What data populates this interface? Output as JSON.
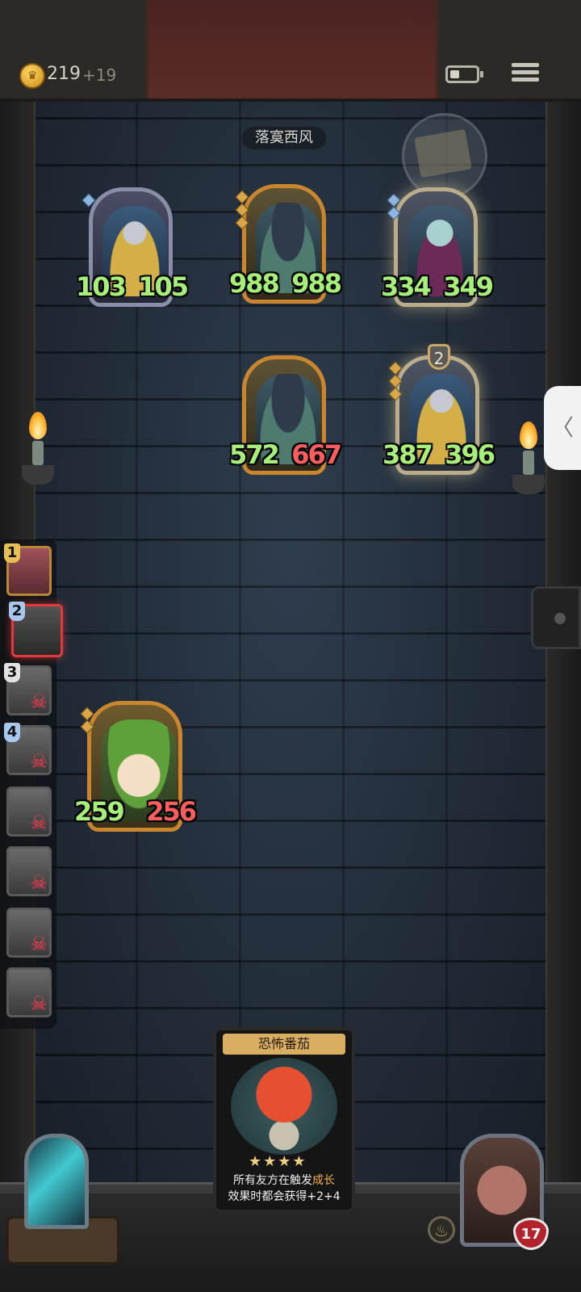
{
  "topbar": {
    "coin_icon": "crown-coin-icon",
    "gold": "219",
    "gold_bonus": "+19",
    "battery_level": 0.35,
    "menu_icon": "hamburger-menu-icon"
  },
  "area": {
    "title": "落寞西风"
  },
  "enemies": [
    {
      "atk": "103",
      "hp": "105",
      "portrait": "knight",
      "frame": "silver"
    },
    {
      "atk": "988",
      "hp": "988",
      "portrait": "robot",
      "frame": "gold"
    },
    {
      "atk": "334",
      "hp": "349",
      "portrait": "elf",
      "frame": "glow"
    },
    {
      "atk": "572",
      "hp": "667",
      "portrait": "robot",
      "frame": "gold"
    },
    {
      "atk": "387",
      "hp": "396",
      "portrait": "knight",
      "frame": "gold",
      "badge": "2"
    }
  ],
  "ally": {
    "atk": "259",
    "hp": "256",
    "portrait": "leaf-child"
  },
  "roster": [
    {
      "num": "1",
      "status": "alive"
    },
    {
      "num": "2",
      "status": "active"
    },
    {
      "num": "3",
      "status": "dead"
    },
    {
      "num": "4",
      "status": "dead"
    },
    {
      "num": "",
      "status": "dead"
    },
    {
      "num": "",
      "status": "dead"
    },
    {
      "num": "",
      "status": "dead"
    },
    {
      "num": "",
      "status": "dead"
    }
  ],
  "card": {
    "title": "恐怖番茄",
    "stars": "★★★★",
    "desc_pre": "所有友方在触发",
    "desc_kw": "成长",
    "desc_post": "效果时都会获得+2+4"
  },
  "hero": {
    "hp": "17"
  },
  "side_handle": "〈",
  "colors": {
    "atk_green": "#a6f07a",
    "hp_red": "#ff5e5e",
    "frame_gold": "#c9862f",
    "roster_active": "#e23a3a"
  }
}
